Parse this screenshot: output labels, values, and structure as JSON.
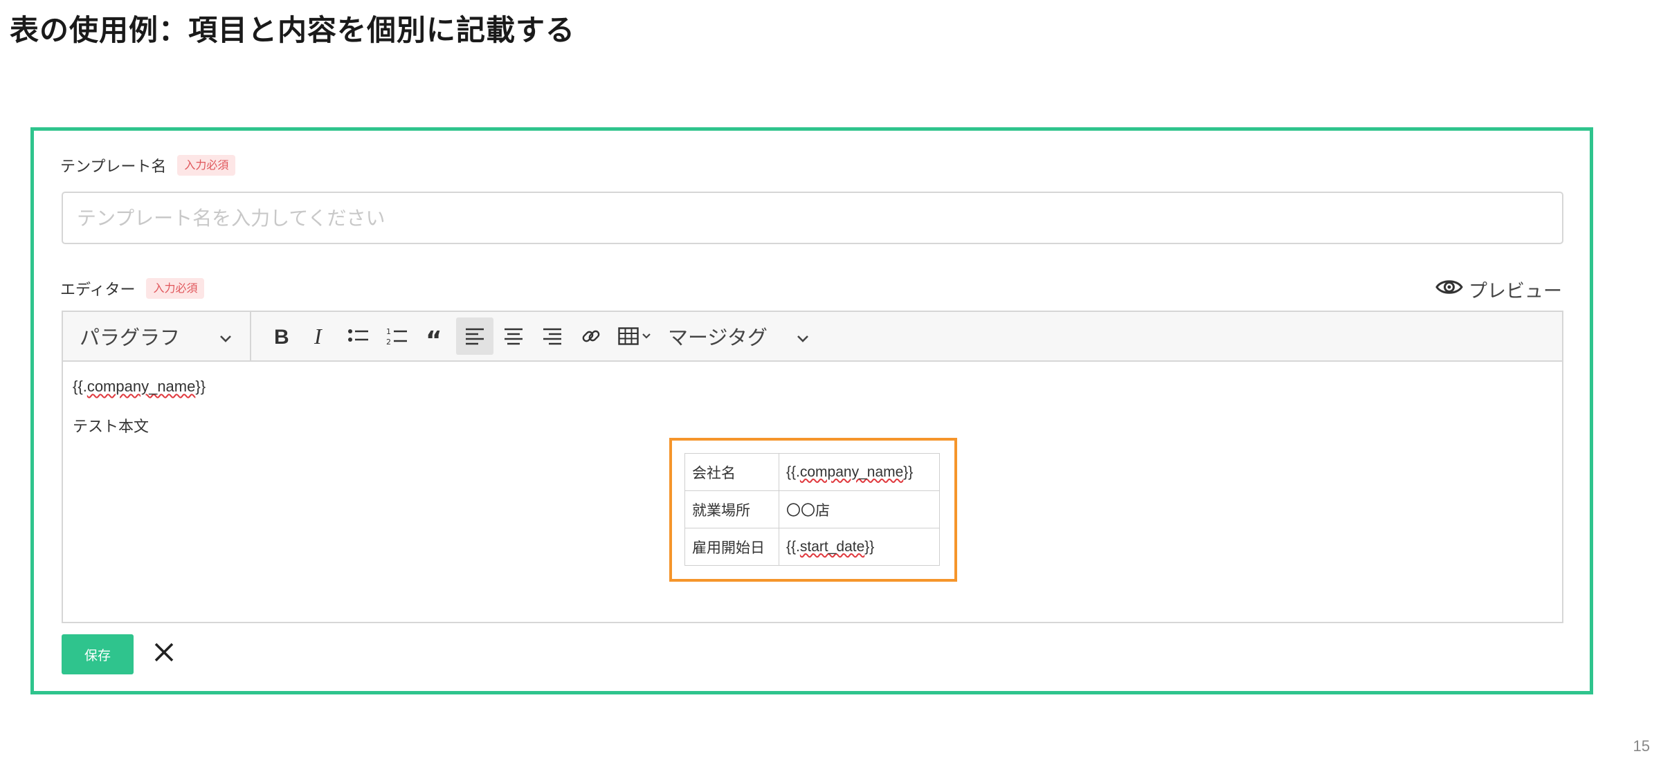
{
  "slide": {
    "title": "表の使用例：項目と内容を個別に記載する",
    "page_number": "15"
  },
  "form": {
    "template_name": {
      "label": "テンプレート名",
      "required": "入力必須",
      "placeholder": "テンプレート名を入力してください",
      "value": ""
    },
    "editor": {
      "label": "エディター",
      "required": "入力必須",
      "preview": "プレビュー",
      "toolbar": {
        "paragraph": "パラグラフ",
        "merge_tag": "マージタグ",
        "icons": [
          "bold-icon",
          "italic-icon",
          "bulleted-list-icon",
          "numbered-list-icon",
          "blockquote-icon",
          "align-left-icon",
          "align-center-icon",
          "align-right-icon",
          "link-icon",
          "table-icon"
        ]
      },
      "content": {
        "line1": "{{.company_name}}",
        "line2": "テスト本文",
        "table": [
          {
            "key": "会社名",
            "value": "{{.company_name}}"
          },
          {
            "key": "就業場所",
            "value": "〇〇店"
          },
          {
            "key": "雇用開始日",
            "value": "{{.start_date}}"
          }
        ]
      }
    },
    "save_label": "保存"
  },
  "colors": {
    "frame": "#2fc48d",
    "highlight": "#f5952b",
    "required_bg": "#fde6e6",
    "required_text": "#e0565b",
    "save_bg": "#2fc48d"
  }
}
